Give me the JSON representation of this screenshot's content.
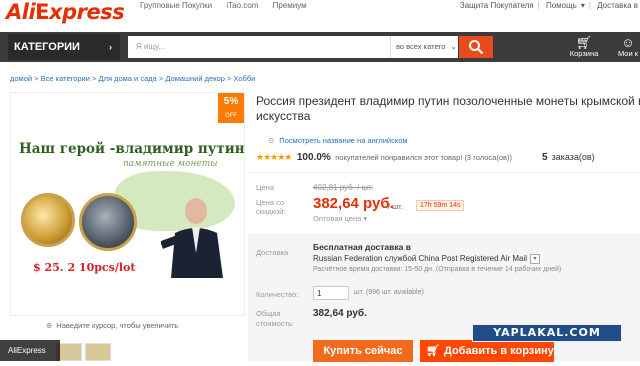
{
  "header": {
    "logo_part1": "Ali",
    "logo_part2": "xpress",
    "top_links": [
      "Групповые Покупки",
      "iTao.com",
      "Премиум"
    ],
    "right_links": [
      "Защита Покупателя",
      "Помощь",
      "Доставка в"
    ]
  },
  "nav": {
    "categories_label": "КАТЕГОРИИ",
    "search_placeholder": "Я ищу...",
    "search_category": "во всех катего",
    "cart_label": "Корзина",
    "orders_label": "Мои к"
  },
  "breadcrumb": [
    "домой",
    "Все категории",
    "Для дома и сада",
    "Домашний декор",
    "Хобби"
  ],
  "product": {
    "title_line1": "Россия президент владимир путин позолоченные монеты крымской вой",
    "title_line2": "искусства",
    "translate_link": "Посмотреть название на английском",
    "stars": "★★★★★",
    "rating_percent": "100.0%",
    "rating_text": "покупателей понравился этот товар! (3 голоса(ов))",
    "orders_count": "5",
    "orders_label": "заказа(ов)"
  },
  "image_ad": {
    "discount_value": "5",
    "discount_unit": "%",
    "discount_word": "OFF",
    "headline": "Наш герой -владимир путин!",
    "subline": "памятные монеты",
    "price": "$ 25. 2  10pcs/lot",
    "zoom_hint": "Наведите курсор, чтобы увеличить"
  },
  "pricing": {
    "price_label": "Цена",
    "old_price": "402,81 руб. / шт.",
    "discount_label_1": "Цена со",
    "discount_label_2": "скидкой:",
    "new_price": "382,64 руб.",
    "per_unit": "/ шт.",
    "timer": "17h 59m 14s",
    "wholesale_link": "Оптовая цена ▾"
  },
  "shipping": {
    "label": "Доставка",
    "free_shipping": "Бесплатная доставка в",
    "carrier_line": "Russian Federation службой China Post Registered Air Mail",
    "delivery_time": "Расчётное время доставки: 15-50 дн. (Отправка в течение 14 рабочих дней)",
    "quantity_label": "Количество:",
    "quantity_value": "1",
    "quantity_note": "шт. (996 шт. available)",
    "total_label_1": "Общая",
    "total_label_2": "стоимость:",
    "total_value": "382,64 руб.",
    "buy_now": "Купить сейчас",
    "add_to_cart": "Добавить в корзину"
  },
  "overlays": {
    "watermark": "YAPLAKAL.COM",
    "source_tag": "AliExpress"
  },
  "colors": {
    "brand": "#e62e04",
    "nav_bg": "#3c3c3c",
    "buy_button": "#f26b1d",
    "cart_button": "#ff4700"
  }
}
